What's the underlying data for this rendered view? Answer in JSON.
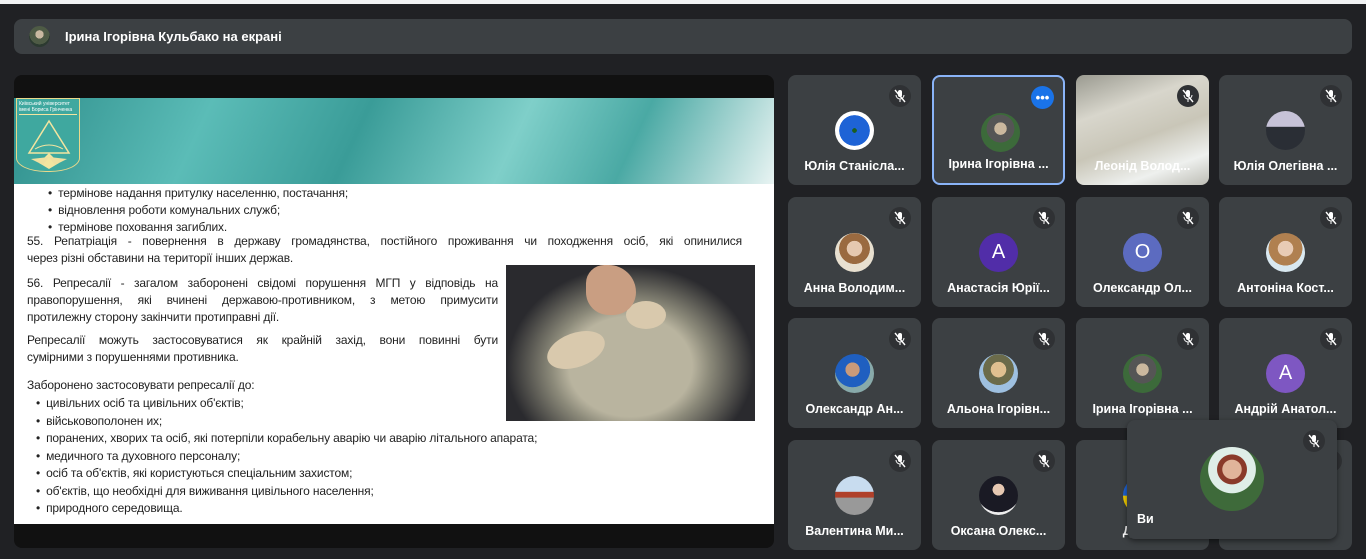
{
  "banner": {
    "text": "Ірина Ігорівна Кульбако на екрані"
  },
  "slide": {
    "logo_text": "Київський університет імені Бориса Грінченка",
    "bullets_top": [
      "термінове надання притулку населенню, постачання;",
      "відновлення роботи комунальних служб;",
      "термінове поховання загиблих."
    ],
    "p55": "55. Репатріація - повернення в державу громадянства, постійного проживання чи походження осіб, які опинилися",
    "p55b": "через різні обставини на території інших держав.",
    "p56": [
      "56. Репресалії - загалом заборонені свідомі порушення МГП у відповідь на",
      "правопорушення, які вчинені державою-противником, з метою примусити",
      "протилежну сторону закінчити протиправні дії."
    ],
    "p_repr": [
      "Репресалії можуть застосовуватися як крайній захід, вони повинні бути",
      "сумірними з порушеннями противника."
    ],
    "forbidden": "Заборонено застосовувати репресалії до:",
    "bullets_bottom": [
      "цивільних осіб та цивільних об'єктів;",
      "військовополонен их;",
      "поранених, хворих та осіб, які потерпіли корабельну аварію чи аварію літального апарата;",
      "медичного та духовного персоналу;",
      "осіб та об'єктів, які користуються спеціальним захистом;",
      "об'єктів, що необхідні для виживання цивільного населення;",
      "природного середовища."
    ]
  },
  "participants": [
    {
      "name": "Юлія Станісла...",
      "avatar": "photo-flower"
    },
    {
      "name": "Ірина Ігорівна ...",
      "avatar": "photo",
      "selected": true,
      "menu": "•••"
    },
    {
      "name": "Леонід Волод...",
      "avatar": "video"
    },
    {
      "name": "Юлія Олегівна ...",
      "avatar": "photo"
    },
    {
      "name": "Анна Володим...",
      "avatar": "photo"
    },
    {
      "name": "Анастасія Юрії...",
      "initial": "А",
      "color": "#512da8"
    },
    {
      "name": "Олександр Ол...",
      "initial": "О",
      "color": "#5c6bc0"
    },
    {
      "name": "Антоніна Кост...",
      "avatar": "photo"
    },
    {
      "name": "Олександр Ан...",
      "avatar": "photo"
    },
    {
      "name": "Альона Ігорівн...",
      "avatar": "photo"
    },
    {
      "name": "Ірина Ігорівна ...",
      "avatar": "photo"
    },
    {
      "name": "Андрій Анатол...",
      "initial": "А",
      "color": "#7e57c2"
    },
    {
      "name": "Валентина Ми...",
      "avatar": "photo"
    },
    {
      "name": "Оксана Олекс...",
      "avatar": "photo"
    },
    {
      "name": "Дмитр",
      "avatar": "photo-flag"
    },
    {
      "name": "",
      "avatar": "hidden"
    }
  ],
  "self": {
    "name": "Ви",
    "muted": true
  },
  "colors": {
    "background": "#202124",
    "tile": "#3c4043",
    "selected_border": "#8ab4f8",
    "menu_button": "#1a73e8"
  }
}
